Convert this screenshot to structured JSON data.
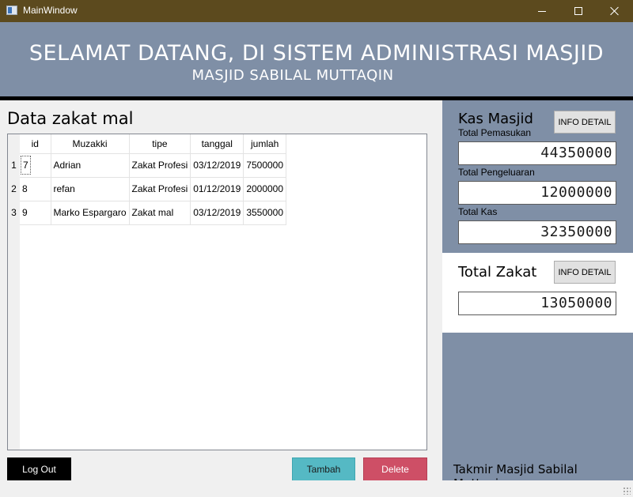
{
  "window": {
    "title": "MainWindow"
  },
  "banner": {
    "title": "SELAMAT DATANG, DI SISTEM ADMINISTRASI MASJID",
    "subtitle": "MASJID SABILAL MUTTAQIN"
  },
  "main": {
    "section_title": "Data zakat mal",
    "table": {
      "columns": [
        "id",
        "Muzakki",
        "tipe",
        "tanggal",
        "jumlah"
      ],
      "rows": [
        {
          "num": "1",
          "id": "7",
          "muzakki": "Adrian",
          "tipe": "Zakat Profesi",
          "tanggal": "03/12/2019",
          "jumlah": "7500000"
        },
        {
          "num": "2",
          "id": "8",
          "muzakki": "refan",
          "tipe": "Zakat Profesi",
          "tanggal": "01/12/2019",
          "jumlah": "2000000"
        },
        {
          "num": "3",
          "id": "9",
          "muzakki": "Marko Espargaro",
          "tipe": "Zakat mal",
          "tanggal": "03/12/2019",
          "jumlah": "3550000"
        }
      ]
    },
    "buttons": {
      "logout": "Log Out",
      "tambah": "Tambah",
      "delete": "Delete"
    }
  },
  "kas": {
    "title": "Kas Masjid",
    "info_button": "INFO DETAIL",
    "pemasukan_label": "Total Pemasukan",
    "pemasukan_value": "44350000",
    "pengeluaran_label": "Total Pengeluaran",
    "pengeluaran_value": "12000000",
    "total_label": "Total Kas",
    "total_value": "32350000"
  },
  "zakat": {
    "title": "Total Zakat",
    "info_button": "INFO DETAIL",
    "value": "13050000"
  },
  "footer": {
    "text": "Takmir Masjid Sabilal Muttaqin"
  },
  "colors": {
    "titlebar": "#5c4a1e",
    "banner": "#7f8fa6",
    "logout": "#000000",
    "tambah": "#55b9c4",
    "delete": "#ce4f66"
  }
}
